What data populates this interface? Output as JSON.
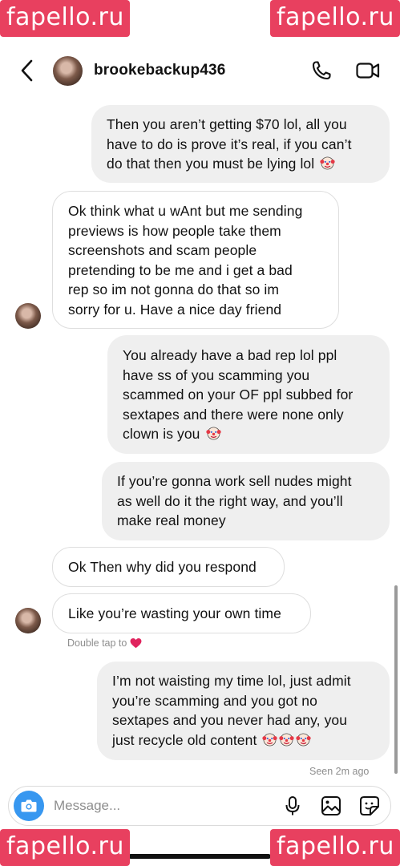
{
  "watermark": {
    "text": "fapello.ru"
  },
  "header": {
    "username": "brookebackup436",
    "back_icon": "chevron-left-icon",
    "call_icon": "phone-icon",
    "video_icon": "video-camera-icon"
  },
  "messages": [
    {
      "type": "sent",
      "lines": [
        "Then you aren’t getting $70 lol, all you",
        "have to do is prove it’s real, if you can’t",
        "do that then you must be lying lol"
      ],
      "emoji": "clown-face"
    },
    {
      "type": "received",
      "lines": [
        "Ok think what u wAnt but me sending",
        "previews is how people take them",
        "screenshots and scam people",
        "pretending to be me and i get a bad",
        "rep so im not gonna do that so im",
        "sorry for u. Have a nice day friend"
      ]
    },
    {
      "type": "sent",
      "lines": [
        "You already have a bad rep lol ppl",
        "have ss of you scamming you",
        "scammed on your OF ppl subbed for",
        "sextapes and there were none only",
        "clown is you"
      ],
      "emoji": "clown-face"
    },
    {
      "type": "sent",
      "lines": [
        "If you’re gonna work sell nudes might",
        "as well do it the right way, and you’ll",
        "make real money"
      ]
    },
    {
      "type": "received",
      "lines": [
        "Ok Then why did you respond"
      ]
    },
    {
      "type": "received",
      "lines": [
        "Like you’re wasting your own time"
      ]
    },
    {
      "type": "sent",
      "lines": [
        "I’m not waisting my time lol, just admit",
        "you’re scamming and you got no",
        "sextapes and you never had any, you",
        "just recycle old content"
      ],
      "emoji": "clown-face x3"
    }
  ],
  "hints": {
    "double_tap": "Double tap to",
    "seen": "Seen 2m ago"
  },
  "composer": {
    "placeholder": "Message...",
    "icons": [
      "camera-icon",
      "microphone-icon",
      "gallery-icon",
      "sticker-icon"
    ]
  },
  "colors": {
    "accent": "#3797f0",
    "sent_bubble": "#efefef",
    "heart": "#e0245e",
    "watermark": "#e8405f"
  }
}
